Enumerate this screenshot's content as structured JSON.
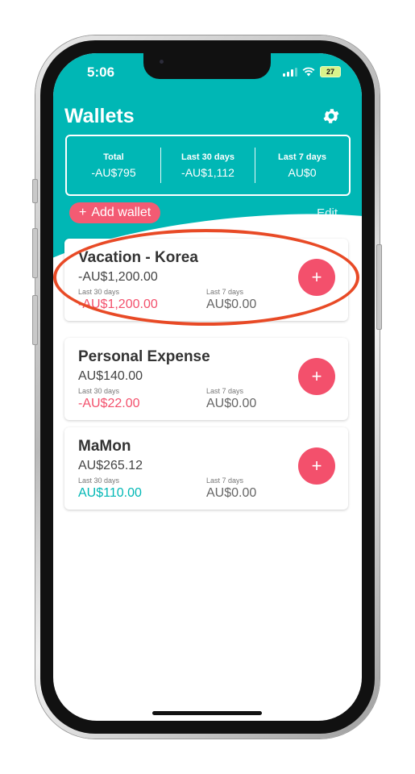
{
  "status": {
    "time": "5:06",
    "battery": "27"
  },
  "header": {
    "title": "Wallets",
    "settings_icon": "gear-icon"
  },
  "summary": [
    {
      "label": "Total",
      "value": "-AU$795"
    },
    {
      "label": "Last 30 days",
      "value": "-AU$1,112"
    },
    {
      "label": "Last 7 days",
      "value": "AU$0"
    }
  ],
  "actions": {
    "add_wallet": "Add wallet",
    "edit": "Edit"
  },
  "wallets": [
    {
      "name": "Vacation - Korea",
      "balance": "-AU$1,200.00",
      "last30_label": "Last 30 days",
      "last30": "-AU$1,200.00",
      "last7_label": "Last 7 days",
      "last7": "AU$0.00"
    },
    {
      "name": "Personal Expense",
      "balance": "AU$140.00",
      "last30_label": "Last 30 days",
      "last30": "-AU$22.00",
      "last7_label": "Last 7 days",
      "last7": "AU$0.00"
    },
    {
      "name": "MaMon",
      "balance": "AU$265.12",
      "last30_label": "Last 30 days",
      "last30": "AU$110.00",
      "last7_label": "Last 7 days",
      "last7": "AU$0.00"
    }
  ],
  "colors": {
    "header": "#00b7b5",
    "accent": "#f3506c",
    "negative": "#f3506c",
    "positive": "#00b7b5",
    "highlight": "#e84a26"
  }
}
